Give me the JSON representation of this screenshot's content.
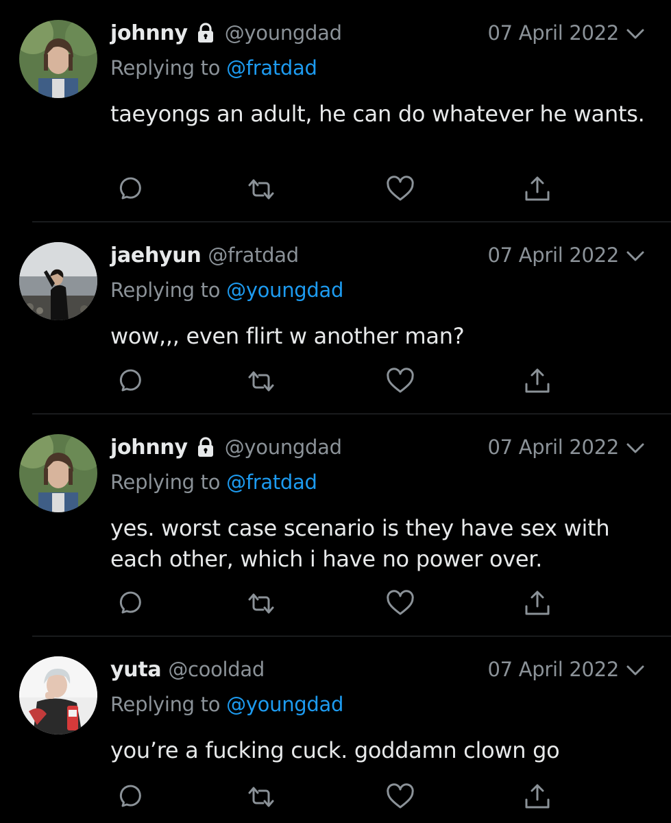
{
  "colors": {
    "background": "#000000",
    "primary_text": "#e7e9ea",
    "secondary_text": "#8b9298",
    "mention": "#1d9bf0",
    "divider": "#2f3336"
  },
  "icons": {
    "lock": "lock-icon",
    "menu": "chevron-down-icon",
    "reply": "reply-icon",
    "retweet": "retweet-icon",
    "like": "heart-icon",
    "share": "share-icon"
  },
  "tweets": [
    {
      "name": "johnny",
      "protected": true,
      "handle": "@youngdad",
      "date": "07 April 2022",
      "replying_prefix": "Replying to",
      "replying_to": "@fratdad",
      "text": "taeyongs an adult, he can do whatever he wants."
    },
    {
      "name": "jaehyun",
      "protected": false,
      "handle": "@fratdad",
      "date": "07 April 2022",
      "replying_prefix": "Replying to",
      "replying_to": "@youngdad",
      "text": "wow,,, even flirt w another man?"
    },
    {
      "name": "johnny",
      "protected": true,
      "handle": "@youngdad",
      "date": "07 April 2022",
      "replying_prefix": "Replying to",
      "replying_to": "@fratdad",
      "text": "yes. worst case scenario is they have sex with each other, which i have no power over."
    },
    {
      "name": "yuta",
      "protected": false,
      "handle": "@cooldad",
      "date": "07 April 2022",
      "replying_prefix": "Replying to",
      "replying_to": "@youngdad",
      "text": "you’re a fucking cuck. goddamn clown go"
    }
  ]
}
